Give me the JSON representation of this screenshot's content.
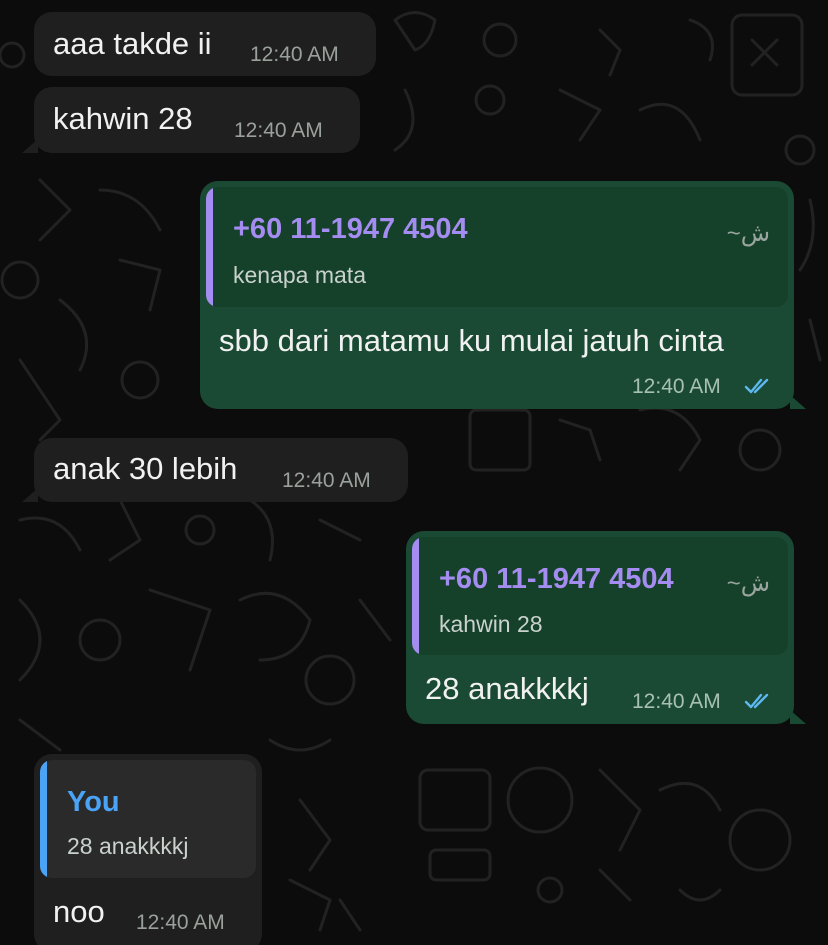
{
  "colors": {
    "incoming_bubble": "#1f1f1f",
    "outgoing_bubble": "#1a4a34",
    "quote_name_contact": "#a48cf0",
    "quote_name_self": "#4aa3f5",
    "read_ticks": "#5db8f0"
  },
  "messages": [
    {
      "direction": "incoming",
      "text": "aaa takde ii",
      "time": "12:40 AM"
    },
    {
      "direction": "incoming",
      "text": "kahwin 28",
      "time": "12:40 AM"
    },
    {
      "direction": "outgoing",
      "quote": {
        "name": "+60 11-1947 4504",
        "alias": "~ش",
        "text": "kenapa mata"
      },
      "text": "sbb dari matamu ku mulai jatuh cinta",
      "time": "12:40 AM",
      "status_icon": "double-check-read-icon"
    },
    {
      "direction": "incoming",
      "text": "anak 30 lebih",
      "time": "12:40 AM"
    },
    {
      "direction": "outgoing",
      "quote": {
        "name": "+60 11-1947 4504",
        "alias": "~ش",
        "text": "kahwin 28"
      },
      "text": "28 anakkkkj",
      "time": "12:40 AM",
      "status_icon": "double-check-read-icon"
    },
    {
      "direction": "incoming",
      "quote": {
        "name": "You",
        "text": "28 anakkkkj"
      },
      "text": "noo",
      "time": "12:40 AM"
    }
  ]
}
